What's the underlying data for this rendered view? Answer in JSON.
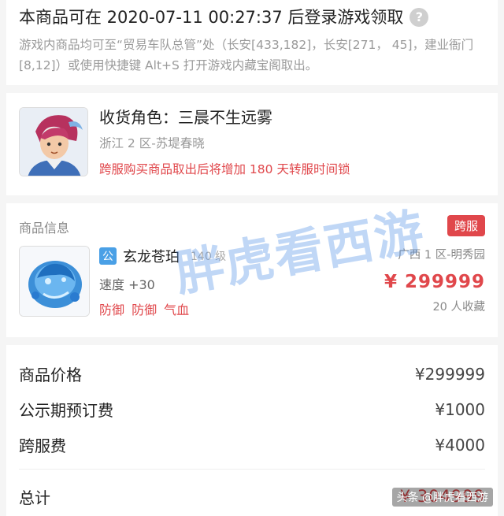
{
  "notice": {
    "title": "本商品可在 2020-07-11 00:27:37 后登录游戏领取",
    "help_glyph": "?",
    "desc": "游戏内商品均可至“贸易车队总管”处（长安[433,182]，长安[271， 45]，建业衙门[8,12]）或使用快捷键 Alt+S 打开游戏内藏宝阁取出。"
  },
  "receiver": {
    "name": "收货角色：三晨不生远雾",
    "server": "浙江 2 区-苏堤春晓",
    "warning": "跨服购买商品取出后将增加 180 天转服时间锁"
  },
  "goods": {
    "header": "商品信息",
    "cross_badge": "跨服",
    "public_badge": "公",
    "name": "玄龙苍珀",
    "level": "140 级",
    "speed": "速度 +30",
    "stats": "防御 防御 气血",
    "server": "广西 1 区-明秀园",
    "price": "¥ 299999",
    "favorites": "20 人收藏"
  },
  "fees": {
    "items": [
      {
        "label": "商品价格",
        "value": "¥299999"
      },
      {
        "label": "公示期预订费",
        "value": "¥1000"
      },
      {
        "label": "跨服费",
        "value": "¥4000"
      }
    ],
    "total_label": "总计",
    "total_value": "¥ 304999"
  },
  "watermark": "胖虎看西游",
  "credit": "头条 @胖虎看西游"
}
